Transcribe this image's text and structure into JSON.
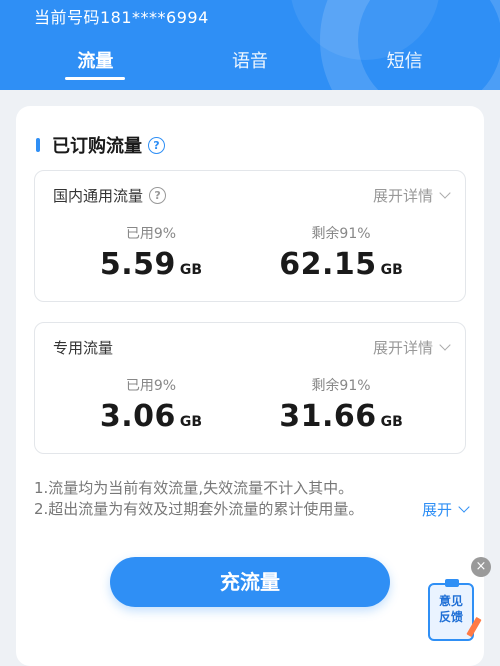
{
  "header": {
    "phone_line": "当前号码181****6994",
    "tabs": [
      {
        "label": "流量",
        "active": true
      },
      {
        "label": "语音",
        "active": false
      },
      {
        "label": "短信",
        "active": false
      }
    ]
  },
  "section": {
    "title": "已订购流量",
    "help_icon": "question-circle-icon"
  },
  "packages": [
    {
      "name": "国内通用流量",
      "has_help": true,
      "expand_label": "展开详情",
      "used_label": "已用9%",
      "used_value": "5.59",
      "used_unit": "GB",
      "remain_label": "剩余91%",
      "remain_value": "62.15",
      "remain_unit": "GB"
    },
    {
      "name": "专用流量",
      "has_help": false,
      "expand_label": "展开详情",
      "used_label": "已用9%",
      "used_value": "3.06",
      "used_unit": "GB",
      "remain_label": "剩余91%",
      "remain_value": "31.66",
      "remain_unit": "GB"
    }
  ],
  "notes": {
    "line1": "1.流量均为当前有效流量,失效流量不计入其中。",
    "line2": "2.超出流量为有效及过期套外流量的累计使用量。",
    "expand_label": "展开"
  },
  "charge_button": "充流量",
  "feedback": {
    "line1": "意见",
    "line2": "反馈",
    "close": "×"
  },
  "colors": {
    "accent": "#2f8ff5",
    "muted": "#888888",
    "background": "#eef1f5"
  }
}
